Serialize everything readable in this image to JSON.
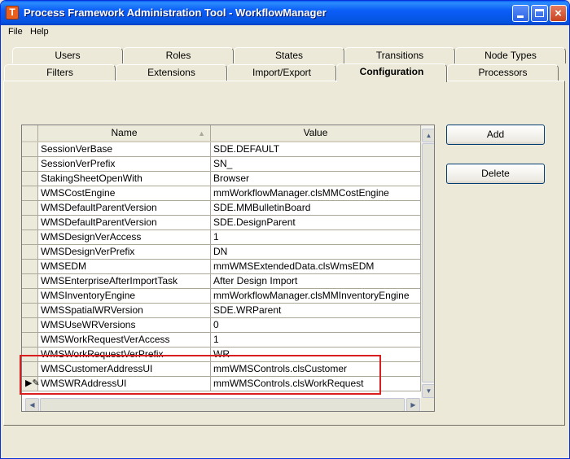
{
  "window": {
    "title": "Process Framework Administration Tool - WorkflowManager",
    "icon_letter": "T",
    "minimize_glyph": "",
    "close_glyph": "×"
  },
  "menu": [
    "File",
    "Help"
  ],
  "tabs_back": [
    "Users",
    "Roles",
    "States",
    "Transitions",
    "Node Types"
  ],
  "tabs_front": [
    "Filters",
    "Extensions",
    "Import/Export",
    "Configuration",
    "Processors"
  ],
  "active_tab": "Configuration",
  "grid": {
    "columns": {
      "name": "Name",
      "value": "Value"
    },
    "sort_glyph": "▲",
    "rows": [
      {
        "name": "SessionVerBase",
        "value": "SDE.DEFAULT"
      },
      {
        "name": "SessionVerPrefix",
        "value": "SN_"
      },
      {
        "name": "StakingSheetOpenWith",
        "value": "Browser"
      },
      {
        "name": "WMSCostEngine",
        "value": "mmWorkflowManager.clsMMCostEngine"
      },
      {
        "name": "WMSDefaultParentVersion",
        "value": "SDE.MMBulletinBoard"
      },
      {
        "name": "WMSDefaultParentVersion",
        "value": "SDE.DesignParent"
      },
      {
        "name": "WMSDesignVerAccess",
        "value": "1"
      },
      {
        "name": "WMSDesignVerPrefix",
        "value": "DN"
      },
      {
        "name": "WMSEDM",
        "value": "mmWMSExtendedData.clsWmsEDM"
      },
      {
        "name": "WMSEnterpriseAfterImportTask",
        "value": "After Design Import"
      },
      {
        "name": "WMSInventoryEngine",
        "value": "mmWorkflowManager.clsMMInventoryEngine"
      },
      {
        "name": "WMSSpatialWRVersion",
        "value": "SDE.WRParent"
      },
      {
        "name": "WMSUseWRVersions",
        "value": "0"
      },
      {
        "name": "WMSWorkRequestVerAccess",
        "value": "1"
      },
      {
        "name": "WMSWorkRequestVerPrefix",
        "value": "WR"
      },
      {
        "name": "WMSCustomerAddressUI",
        "value": "mmWMSControls.clsCustomer"
      },
      {
        "name": "WMSWRAddressUI",
        "value": "mmWMSControls.clsWorkRequest",
        "editing": true
      }
    ],
    "edit_row_glyph": "▶✎"
  },
  "buttons": {
    "add": "Add",
    "delete": "Delete"
  },
  "colors": {
    "title_bar": "#0a5df7",
    "highlight": "#d81e1e",
    "face": "#ece9d8"
  }
}
